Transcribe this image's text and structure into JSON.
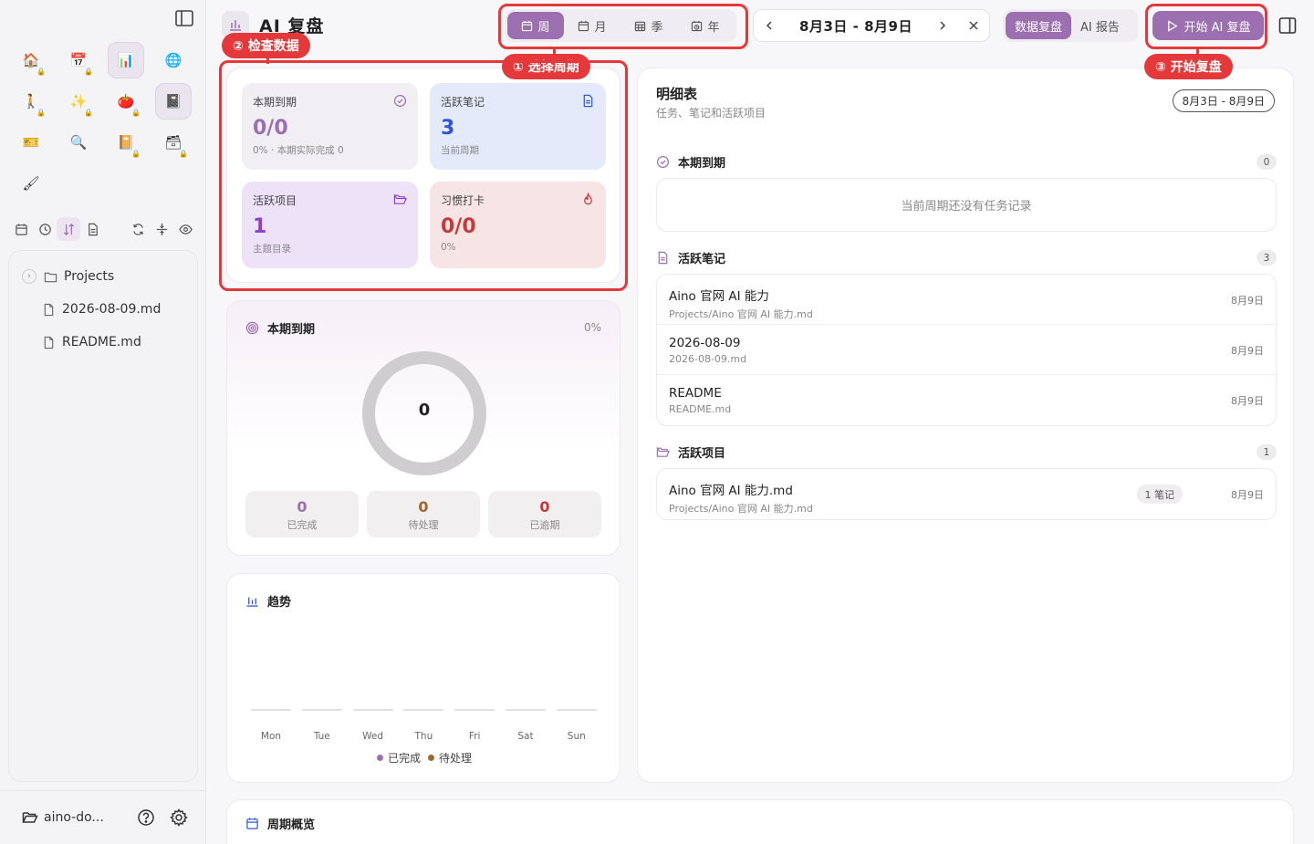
{
  "app": {
    "title": "AI 复盘",
    "logo_icon": "bar-chart-icon"
  },
  "sidebar": {
    "apps": [
      {
        "name": "home-app-icon",
        "glyph": "🏠",
        "locked": true,
        "active": false
      },
      {
        "name": "calendar-app-icon",
        "glyph": "📅",
        "locked": true,
        "active": false
      },
      {
        "name": "review-app-icon",
        "glyph": "📊",
        "locked": false,
        "active": true
      },
      {
        "name": "globe-app-icon",
        "glyph": "🌐",
        "locked": false,
        "active": false
      },
      {
        "name": "walk-app-icon",
        "glyph": "🚶",
        "locked": true,
        "active": false
      },
      {
        "name": "sparkle-app-icon",
        "glyph": "✨",
        "locked": true,
        "active": false
      },
      {
        "name": "tomato-app-icon",
        "glyph": "🍅",
        "locked": true,
        "active": false
      },
      {
        "name": "notebook-app-icon",
        "glyph": "📓",
        "locked": false,
        "active": true
      },
      {
        "name": "ticket-app-icon",
        "glyph": "🎫",
        "locked": false,
        "active": false
      },
      {
        "name": "magnifier-app-icon",
        "glyph": "🔍",
        "locked": false,
        "active": false
      },
      {
        "name": "book-app-icon",
        "glyph": "📔",
        "locked": true,
        "active": false
      },
      {
        "name": "box-app-icon",
        "glyph": "🗃",
        "locked": true,
        "active": false
      },
      {
        "name": "brush-app-icon",
        "glyph": "🖌",
        "locked": false,
        "active": false
      }
    ],
    "tree": {
      "folder": "Projects",
      "files": [
        "2026-08-09.md",
        "README.md"
      ]
    },
    "workspace": "aino-do..."
  },
  "header": {
    "periods": [
      {
        "label": "周",
        "active": true
      },
      {
        "label": "月",
        "active": false
      },
      {
        "label": "季",
        "active": false
      },
      {
        "label": "年",
        "active": false
      }
    ],
    "date_range": "8月3日 - 8月9日",
    "views": [
      {
        "label": "数据复盘",
        "active": true
      },
      {
        "label": "AI 报告",
        "active": false
      }
    ],
    "start_label": "开始 AI 复盘"
  },
  "stats": {
    "due": {
      "label": "本期到期",
      "value": "0/0",
      "sub": "0% · 本期实际完成 0"
    },
    "notes": {
      "label": "活跃笔记",
      "value": "3",
      "sub": "当前周期"
    },
    "projects": {
      "label": "活跃项目",
      "value": "1",
      "sub": "主题目录"
    },
    "habits": {
      "label": "习惯打卡",
      "value": "0/0",
      "sub": "0%"
    }
  },
  "due_panel": {
    "title": "本期到期",
    "percent": "0%",
    "center_value": "0",
    "completed": {
      "value": "0",
      "label": "已完成"
    },
    "pending": {
      "value": "0",
      "label": "待处理"
    },
    "overdue": {
      "value": "0",
      "label": "已逾期"
    }
  },
  "trend": {
    "title": "趋势",
    "days": [
      "Mon",
      "Tue",
      "Wed",
      "Thu",
      "Fri",
      "Sat",
      "Sun"
    ],
    "legend_completed": "已完成",
    "legend_pending": "待处理"
  },
  "detail": {
    "title": "明细表",
    "subtitle": "任务、笔记和活跃项目",
    "range": "8月3日 - 8月9日",
    "due_section": {
      "title": "本期到期",
      "count": "0",
      "empty": "当前周期还没有任务记录"
    },
    "notes_section": {
      "title": "活跃笔记",
      "count": "3",
      "items": [
        {
          "name": "Aino 官网 AI 能力",
          "path": "Projects/Aino 官网 AI 能力.md",
          "date": "8月9日"
        },
        {
          "name": "2026-08-09",
          "path": "2026-08-09.md",
          "date": "8月9日"
        },
        {
          "name": "README",
          "path": "README.md",
          "date": "8月9日"
        }
      ]
    },
    "projects_section": {
      "title": "活跃项目",
      "count": "1",
      "items": [
        {
          "name": "Aino 官网 AI 能力.md",
          "path": "Projects/Aino 官网 AI 能力.md",
          "badge": "1 笔记",
          "date": "8月9日"
        }
      ]
    }
  },
  "overview": {
    "title": "周期概览"
  },
  "annotations": {
    "select_period": "① 选择周期",
    "check_data": "② 检查数据",
    "start_review": "③ 开始复盘"
  },
  "colors": {
    "accent": "#9b6fb0",
    "annotation": "#e5383b",
    "due_value": "#9b6fb0",
    "notes_value": "#2f56d6",
    "projects_value": "#8e3fcf",
    "habits_value": "#c53a3a",
    "pending": "#a0662a"
  }
}
